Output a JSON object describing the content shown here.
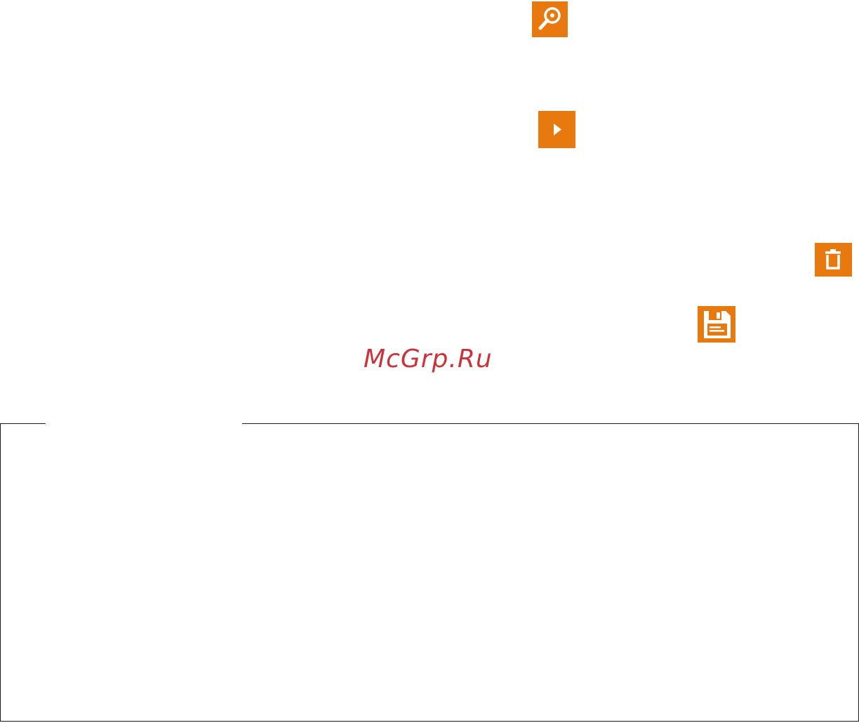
{
  "colors": {
    "accent": "#e8790f",
    "icon_glyph": "#ffffff",
    "watermark": "#c9343b",
    "frame_border": "#1a1a1a"
  },
  "icons": {
    "search": "search-magnifier-icon",
    "play": "play-icon",
    "delete": "trash-icon",
    "save": "floppy-disk-icon"
  },
  "watermark": {
    "text": "McGrp.Ru"
  }
}
